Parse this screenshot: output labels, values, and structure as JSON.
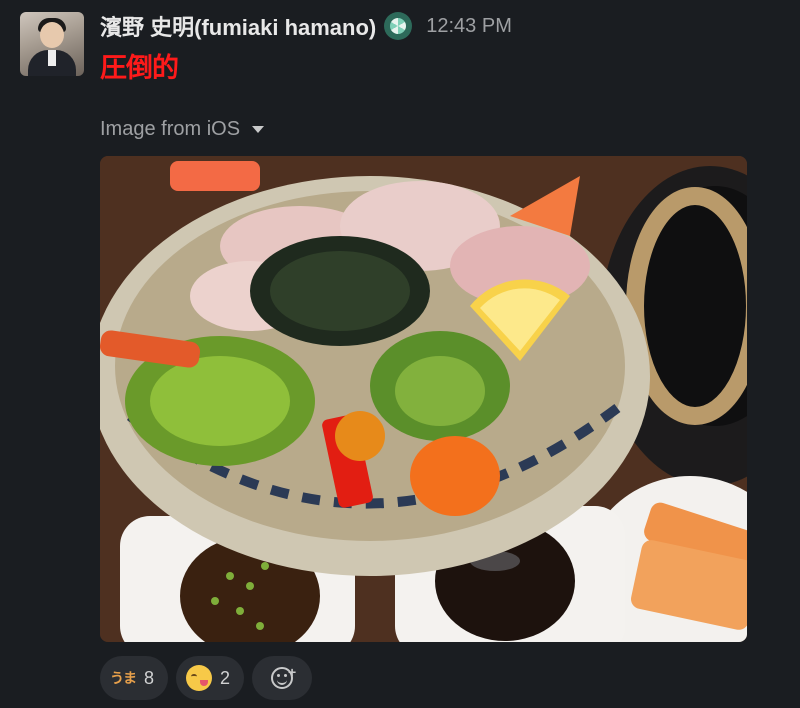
{
  "message": {
    "author": "濱野 史明(fumiaki hamano)",
    "status_icon": "status-emoji-icon",
    "timestamp": "12:43 PM",
    "text": "圧倒的",
    "text_color": "#ff1a1a"
  },
  "attachment": {
    "label": "Image from iOS",
    "toggle_icon": "caret-down-icon"
  },
  "reactions": [
    {
      "emoji": "umai-emoji",
      "emoji_text": "うま",
      "count": "8"
    },
    {
      "emoji": "yum-face-emoji",
      "count": "2"
    }
  ],
  "add_reaction_icon": "add-reaction-icon",
  "colors": {
    "background": "#1a1d21",
    "reaction_bg": "#2b2e33",
    "muted_text": "#9ea0a3"
  }
}
